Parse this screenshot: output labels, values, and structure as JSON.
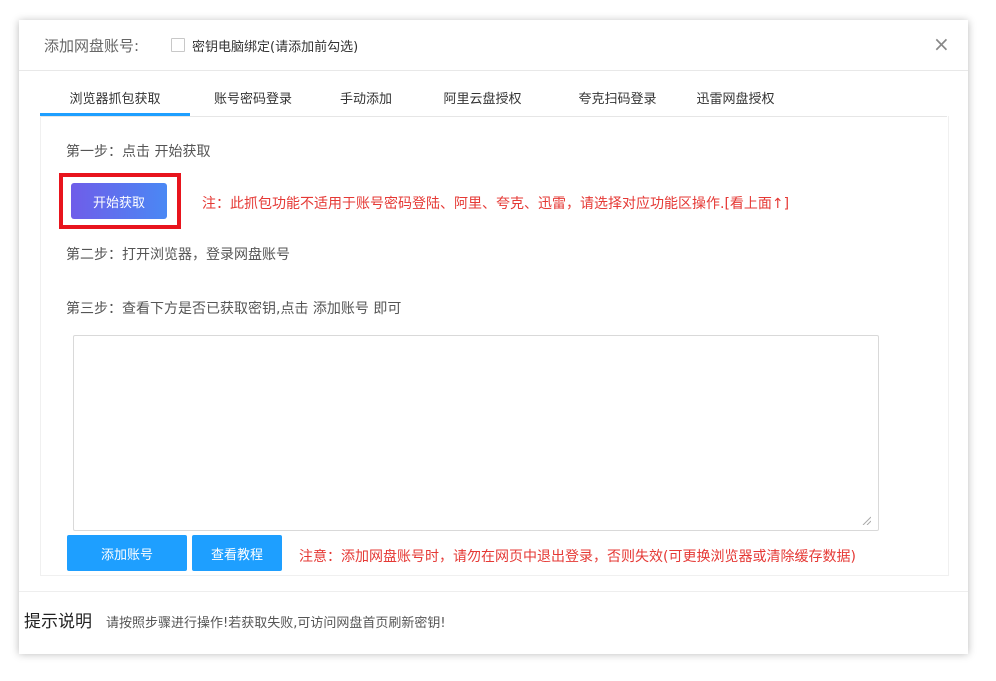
{
  "dialog": {
    "title": "添加网盘账号:",
    "checkbox_label": "密钥电脑绑定(请添加前勾选)",
    "close_symbol": "×"
  },
  "tabs": [
    {
      "label": "浏览器抓包获取",
      "active": true
    },
    {
      "label": "账号密码登录",
      "active": false
    },
    {
      "label": "手动添加",
      "active": false
    },
    {
      "label": "阿里云盘授权",
      "active": false
    },
    {
      "label": "夸克扫码登录",
      "active": false
    },
    {
      "label": "迅雷网盘授权",
      "active": false
    }
  ],
  "steps": {
    "step1": "第一步：点击 开始获取",
    "step2": "第二步：打开浏览器，登录网盘账号",
    "step3": "第三步：查看下方是否已获取密钥,点击 添加账号 即可"
  },
  "start_button": "开始获取",
  "note_top": "注：此抓包功能不适用于账号密码登陆、阿里、夸克、迅雷，请选择对应功能区操作.[看上面↑]",
  "key_textarea": {
    "value": "",
    "placeholder": ""
  },
  "buttons": {
    "add_account": "添加账号",
    "view_tutorial": "查看教程"
  },
  "note_bottom": "注意：添加网盘账号时，请勿在网页中退出登录，否则失效(可更换浏览器或清除缓存数据)",
  "footer": {
    "title": "提示说明",
    "text": "请按照步骤进行操作!若获取失败,可访问网盘首页刷新密钥!"
  },
  "colors": {
    "accent": "#1e9fff",
    "warning_text": "#e53935",
    "highlight_box": "#e8141d",
    "start_button_gradient": [
      "#6f5de9",
      "#4a88f4"
    ]
  }
}
